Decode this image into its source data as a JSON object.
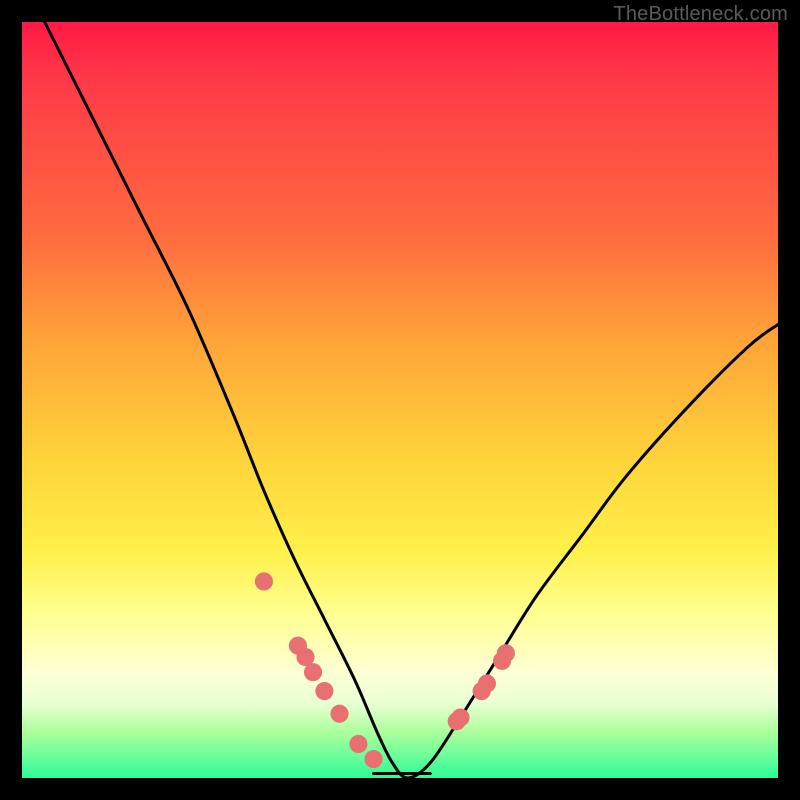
{
  "watermark": "TheBottleneck.com",
  "chart_data": {
    "type": "line",
    "title": "",
    "xlabel": "",
    "ylabel": "",
    "xlim": [
      0,
      100
    ],
    "ylim": [
      0,
      100
    ],
    "grid": false,
    "series": [
      {
        "name": "bottleneck-curve",
        "x": [
          3,
          10,
          16,
          22,
          28,
          32,
          36,
          40,
          44,
          47,
          49,
          51,
          54,
          58,
          63,
          68,
          74,
          80,
          88,
          96,
          100
        ],
        "values": [
          100,
          86,
          74,
          62,
          48,
          38,
          29,
          21,
          13,
          6,
          2,
          0,
          2,
          8,
          16,
          24,
          32,
          40,
          49,
          57,
          60
        ]
      }
    ],
    "markers": {
      "name": "highlight-points",
      "x": [
        32.0,
        36.5,
        37.5,
        38.5,
        40.0,
        42.0,
        44.5,
        46.5,
        57.5,
        58.0,
        60.8,
        61.5,
        63.5,
        64.0
      ],
      "values": [
        26.0,
        17.5,
        16.0,
        14.0,
        11.5,
        8.5,
        4.5,
        2.5,
        7.5,
        8.0,
        11.5,
        12.5,
        15.5,
        16.5
      ],
      "radius": 1.2
    },
    "flat_segment": {
      "name": "minimum-band",
      "x_start": 46.5,
      "x_end": 54.0,
      "y": 0.6
    },
    "background_gradient": {
      "top": "#ff1a44",
      "upper_mid": "#ffd43a",
      "lower_mid": "#ffffd4",
      "bottom": "#2dfc97"
    }
  }
}
